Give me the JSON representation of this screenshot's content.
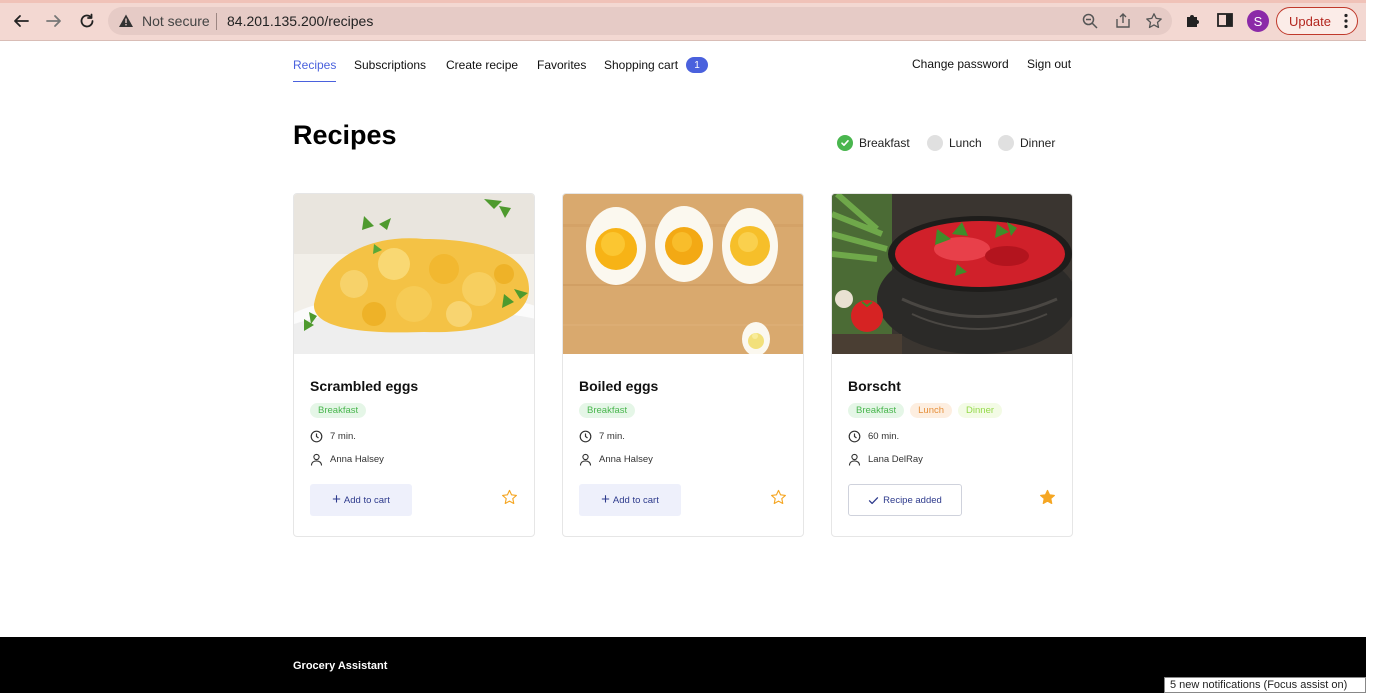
{
  "browser": {
    "security_label": "Not secure",
    "url": "84.201.135.200/recipes",
    "profile_initial": "S",
    "update_label": "Update",
    "icons": [
      "back-arrow-icon",
      "forward-arrow-icon",
      "reload-icon",
      "warning-icon",
      "zoom-icon",
      "share-icon",
      "bookmark-star-icon",
      "extensions-icon",
      "side-panel-icon",
      "kebab-menu-icon"
    ]
  },
  "nav": {
    "items": [
      {
        "label": "Recipes",
        "active": true
      },
      {
        "label": "Subscriptions",
        "active": false
      },
      {
        "label": "Create recipe",
        "active": false
      },
      {
        "label": "Favorites",
        "active": false
      },
      {
        "label": "Shopping cart",
        "active": false
      }
    ],
    "cart_count": "1",
    "change_password": "Change password",
    "sign_out": "Sign out"
  },
  "page": {
    "title": "Recipes"
  },
  "filters": [
    {
      "label": "Breakfast",
      "checked": true
    },
    {
      "label": "Lunch",
      "checked": false
    },
    {
      "label": "Dinner",
      "checked": false
    }
  ],
  "recipes": [
    {
      "title": "Scrambled eggs",
      "tags": [
        "Breakfast"
      ],
      "time": "7 min.",
      "author": "Anna Halsey",
      "action_label": "Add to cart",
      "in_cart": false,
      "favorite": false,
      "image_icon": "scrambled-eggs-photo"
    },
    {
      "title": "Boiled eggs",
      "tags": [
        "Breakfast"
      ],
      "time": "7 min.",
      "author": "Anna Halsey",
      "action_label": "Add to cart",
      "in_cart": false,
      "favorite": false,
      "image_icon": "boiled-eggs-photo"
    },
    {
      "title": "Borscht",
      "tags": [
        "Breakfast",
        "Lunch",
        "Dinner"
      ],
      "time": "60 min.",
      "author": "Lana DelRay",
      "action_label": "Recipe added",
      "in_cart": true,
      "favorite": true,
      "image_icon": "borscht-photo"
    }
  ],
  "colors": {
    "accent": "#4a61dd",
    "breakfast": "#49b64e",
    "lunch": "#e58f3a",
    "dinner": "#94d94a",
    "star": "#f5a623"
  },
  "footer": {
    "title": "Grocery Assistant"
  },
  "system_toast": "5 new notifications (Focus assist on)"
}
